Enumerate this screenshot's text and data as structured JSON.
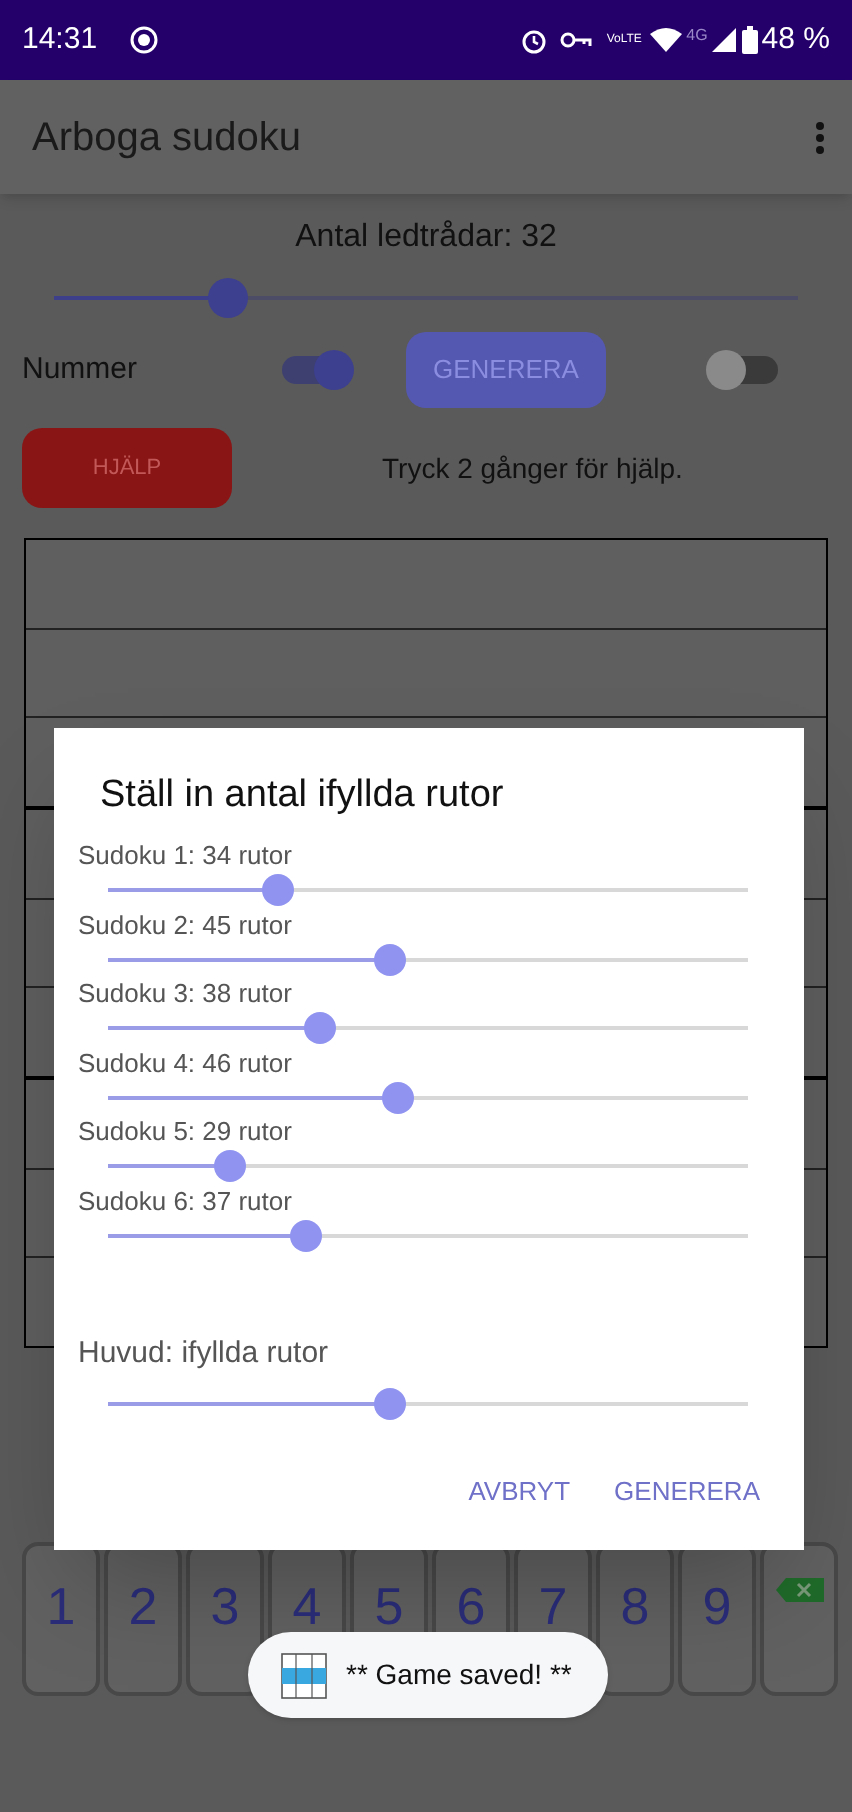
{
  "status_bar": {
    "time": "14:31",
    "volte": "VoLTE",
    "network": "4G",
    "battery": "48 %"
  },
  "app_bar": {
    "title": "Arboga sudoku"
  },
  "clues": {
    "label": "Antal ledtrådar: 32",
    "level": 0.235
  },
  "controls": {
    "numbers_label": "Nummer",
    "numbers_on": true,
    "generate_button": "GENERERA",
    "second_toggle_on": false
  },
  "help": {
    "button": "HJÄLP",
    "hint": "Tryck 2 gånger för hjälp."
  },
  "dialog": {
    "title": "Ställ in antal ifyllda rutor",
    "sliders": [
      {
        "label": "Sudoku 1: 34 rutor",
        "level": 0.266
      },
      {
        "label": "Sudoku 2: 45 rutor",
        "level": 0.44
      },
      {
        "label": "Sudoku 3: 38 rutor",
        "level": 0.33
      },
      {
        "label": "Sudoku 4: 46 rutor",
        "level": 0.453
      },
      {
        "label": "Sudoku 5: 29 rutor",
        "level": 0.19
      },
      {
        "label": "Sudoku 6: 37 rutor",
        "level": 0.31
      }
    ],
    "main_slider": {
      "label": "Huvud: ifyllda rutor",
      "level": 0.44
    },
    "buttons": [
      "AVBRYT",
      "GENERERA"
    ]
  },
  "keypad": [
    {
      "kind": "digit",
      "label": "1"
    },
    {
      "kind": "digit",
      "label": "2"
    },
    {
      "kind": "digit",
      "label": "3"
    },
    {
      "kind": "digit",
      "label": "4"
    },
    {
      "kind": "digit",
      "label": "5"
    },
    {
      "kind": "digit",
      "label": "6"
    },
    {
      "kind": "digit",
      "label": "7"
    },
    {
      "kind": "digit",
      "label": "8"
    },
    {
      "kind": "digit",
      "label": "9"
    },
    {
      "kind": "delete"
    }
  ],
  "toast": {
    "text": "** Game saved! **"
  }
}
